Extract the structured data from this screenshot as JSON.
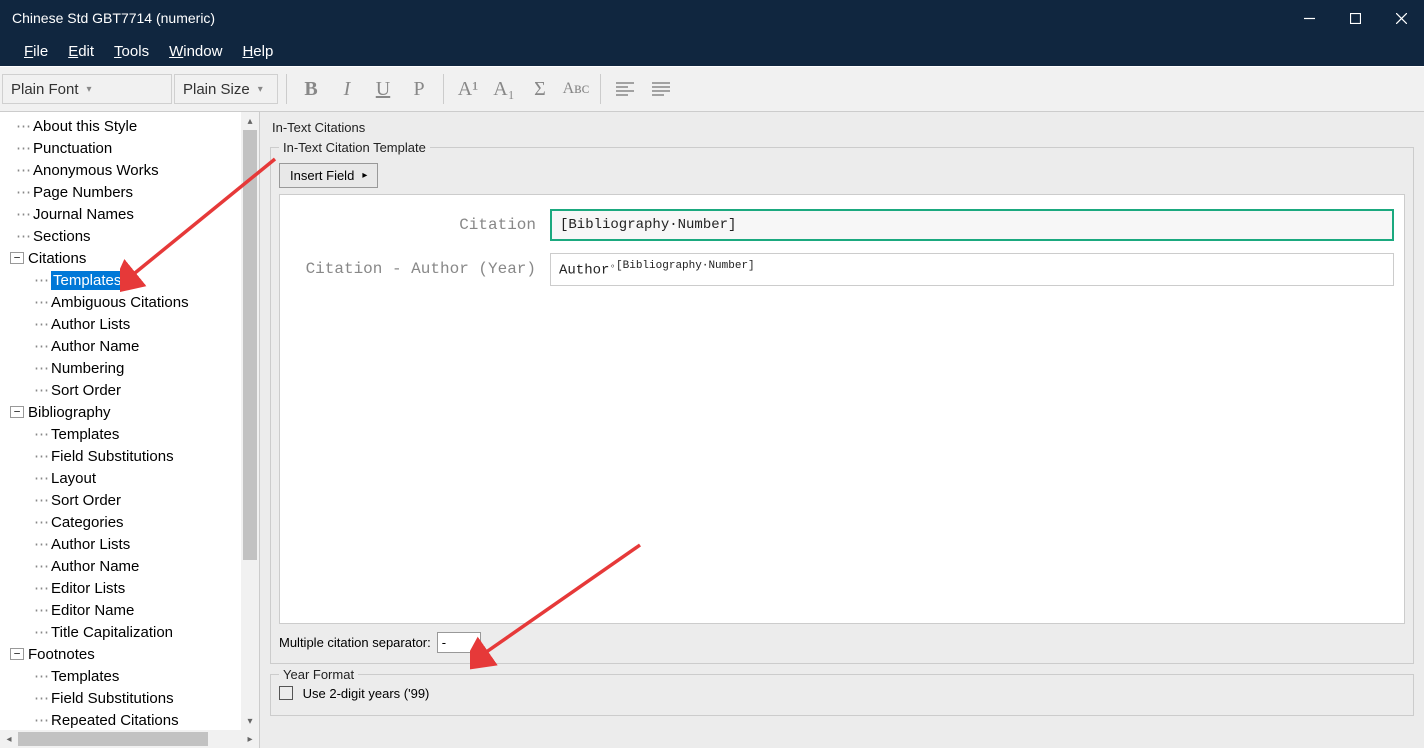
{
  "window": {
    "title": "Chinese Std GBT7714 (numeric)"
  },
  "menu": {
    "file": "File",
    "edit": "Edit",
    "tools": "Tools",
    "window": "Window",
    "help": "Help"
  },
  "toolbar": {
    "font_name": "Plain Font",
    "font_size": "Plain Size",
    "bold": "B",
    "italic": "I",
    "underline": "U",
    "plain": "P",
    "sup": "A¹",
    "sub": "A₁",
    "sigma": "Σ",
    "smallcaps": "Aʙᴄ"
  },
  "tree": {
    "items": [
      {
        "level": 1,
        "label": "About this Style"
      },
      {
        "level": 1,
        "label": "Punctuation"
      },
      {
        "level": 1,
        "label": "Anonymous Works"
      },
      {
        "level": 1,
        "label": "Page Numbers"
      },
      {
        "level": 1,
        "label": "Journal Names"
      },
      {
        "level": 1,
        "label": "Sections"
      },
      {
        "level": 0,
        "exp": "−",
        "label": "Citations"
      },
      {
        "level": 2,
        "label": "Templates",
        "sel": true
      },
      {
        "level": 2,
        "label": "Ambiguous Citations"
      },
      {
        "level": 2,
        "label": "Author Lists"
      },
      {
        "level": 2,
        "label": "Author Name"
      },
      {
        "level": 2,
        "label": "Numbering"
      },
      {
        "level": 2,
        "label": "Sort Order"
      },
      {
        "level": 0,
        "exp": "−",
        "label": "Bibliography"
      },
      {
        "level": 2,
        "label": "Templates"
      },
      {
        "level": 2,
        "label": "Field Substitutions"
      },
      {
        "level": 2,
        "label": "Layout"
      },
      {
        "level": 2,
        "label": "Sort Order"
      },
      {
        "level": 2,
        "label": "Categories"
      },
      {
        "level": 2,
        "label": "Author Lists"
      },
      {
        "level": 2,
        "label": "Author Name"
      },
      {
        "level": 2,
        "label": "Editor Lists"
      },
      {
        "level": 2,
        "label": "Editor Name"
      },
      {
        "level": 2,
        "label": "Title Capitalization"
      },
      {
        "level": 0,
        "exp": "−",
        "label": "Footnotes"
      },
      {
        "level": 2,
        "label": "Templates"
      },
      {
        "level": 2,
        "label": "Field Substitutions"
      },
      {
        "level": 2,
        "label": "Repeated Citations"
      }
    ]
  },
  "panel": {
    "title": "In-Text Citations",
    "template_group": "In-Text Citation Template",
    "insert_field": "Insert Field",
    "rows": {
      "citation_label": "Citation",
      "citation_value": "[Bibliography·Number]",
      "citation_ay_label": "Citation - Author (Year)",
      "citation_ay_prefix": "Author",
      "citation_ay_sup": "[Bibliography·Number]"
    },
    "separator_label": "Multiple citation separator:",
    "separator_value": "-",
    "year_format_group": "Year Format",
    "year_format_checkbox": "Use 2-digit years ('99)"
  }
}
